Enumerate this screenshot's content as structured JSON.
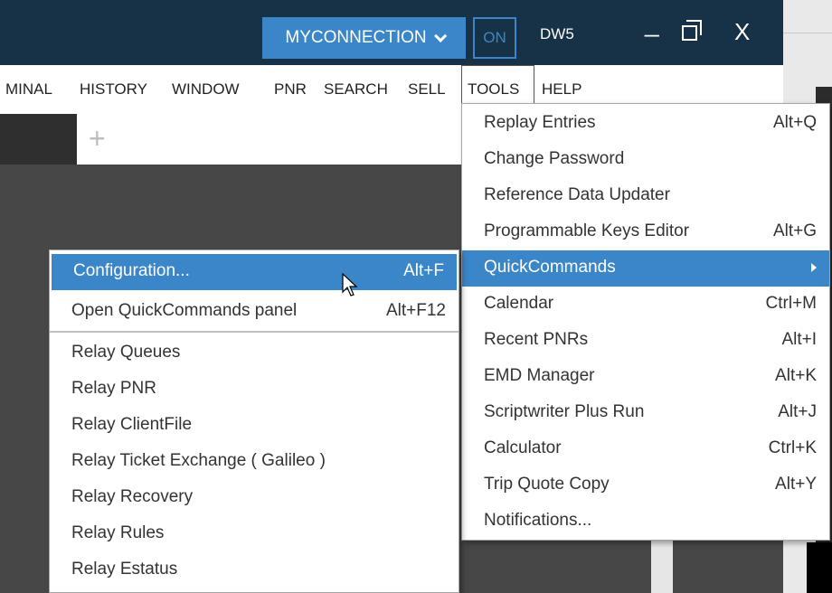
{
  "titlebar": {
    "connection_label": "MYCONNECTION",
    "on_label": "ON",
    "workstation": "DW5",
    "minimize_glyph": "_",
    "close_glyph": "X"
  },
  "menubar": {
    "items": [
      "MINAL",
      "HISTORY",
      "WINDOW",
      "PNR",
      "SEARCH",
      "SELL",
      "TOOLS",
      "HELP"
    ]
  },
  "workspace": {
    "new_tab_glyph": "+"
  },
  "tools_menu": {
    "items": [
      {
        "label": "Replay Entries",
        "shortcut": "Alt+Q"
      },
      {
        "label": "Change Password",
        "shortcut": ""
      },
      {
        "label": "Reference Data Updater",
        "shortcut": ""
      },
      {
        "label": "Programmable Keys Editor",
        "shortcut": "Alt+G"
      },
      {
        "label": "QuickCommands",
        "shortcut": ""
      },
      {
        "label": "Calendar",
        "shortcut": "Ctrl+M"
      },
      {
        "label": "Recent PNRs",
        "shortcut": "Alt+I"
      },
      {
        "label": "EMD Manager",
        "shortcut": "Alt+K"
      },
      {
        "label": "Scriptwriter Plus Run",
        "shortcut": "Alt+J"
      },
      {
        "label": "Calculator",
        "shortcut": "Ctrl+K"
      },
      {
        "label": "Trip Quote Copy",
        "shortcut": "Alt+Y"
      },
      {
        "label": "Notifications...",
        "shortcut": ""
      }
    ]
  },
  "quickcommands_menu": {
    "items": [
      {
        "label": "Configuration...",
        "shortcut": "Alt+F"
      },
      {
        "label": "Open QuickCommands panel",
        "shortcut": "Alt+F12"
      },
      {
        "label": "Relay Queues",
        "shortcut": ""
      },
      {
        "label": "Relay PNR",
        "shortcut": ""
      },
      {
        "label": "Relay ClientFile",
        "shortcut": ""
      },
      {
        "label": "Relay Ticket Exchange ( Galileo )",
        "shortcut": ""
      },
      {
        "label": "Relay Recovery",
        "shortcut": ""
      },
      {
        "label": "Relay Rules",
        "shortcut": ""
      },
      {
        "label": "Relay Estatus",
        "shortcut": ""
      }
    ]
  },
  "colors": {
    "titlebar": "#173247",
    "accent": "#3a86c8",
    "workspace": "#474747"
  }
}
